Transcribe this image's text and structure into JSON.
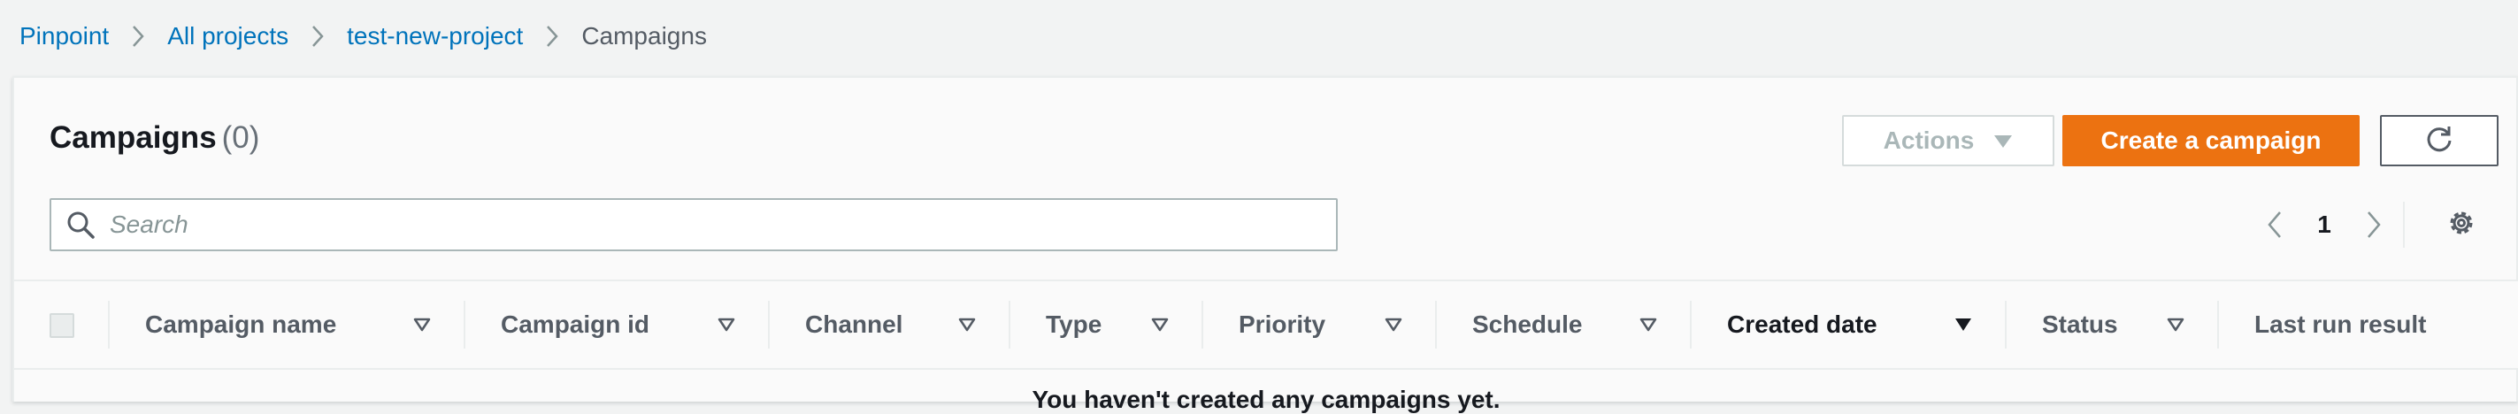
{
  "breadcrumb": {
    "items": [
      "Pinpoint",
      "All projects",
      "test-new-project"
    ],
    "current": "Campaigns"
  },
  "header": {
    "title": "Campaigns",
    "count": "(0)"
  },
  "buttons": {
    "actions": "Actions",
    "create": "Create a campaign"
  },
  "search": {
    "placeholder": "Search",
    "value": ""
  },
  "pagination": {
    "page": "1"
  },
  "table": {
    "columns": [
      {
        "label": "Campaign name",
        "sorted": false
      },
      {
        "label": "Campaign id",
        "sorted": false
      },
      {
        "label": "Channel",
        "sorted": false
      },
      {
        "label": "Type",
        "sorted": false
      },
      {
        "label": "Priority",
        "sorted": false
      },
      {
        "label": "Schedule",
        "sorted": false
      },
      {
        "label": "Created date",
        "sorted": true
      },
      {
        "label": "Status",
        "sorted": false
      },
      {
        "label": "Last run result",
        "sorted": false
      }
    ],
    "empty_message": "You haven't created any campaigns yet."
  },
  "colors": {
    "link": "#0073bb",
    "primary": "#ec7211",
    "page_bg": "#f2f3f3"
  },
  "icons": [
    "chevron-right-icon",
    "caret-down-icon",
    "refresh-icon",
    "search-icon",
    "chevron-left-icon",
    "settings-icon",
    "sort-icon"
  ]
}
